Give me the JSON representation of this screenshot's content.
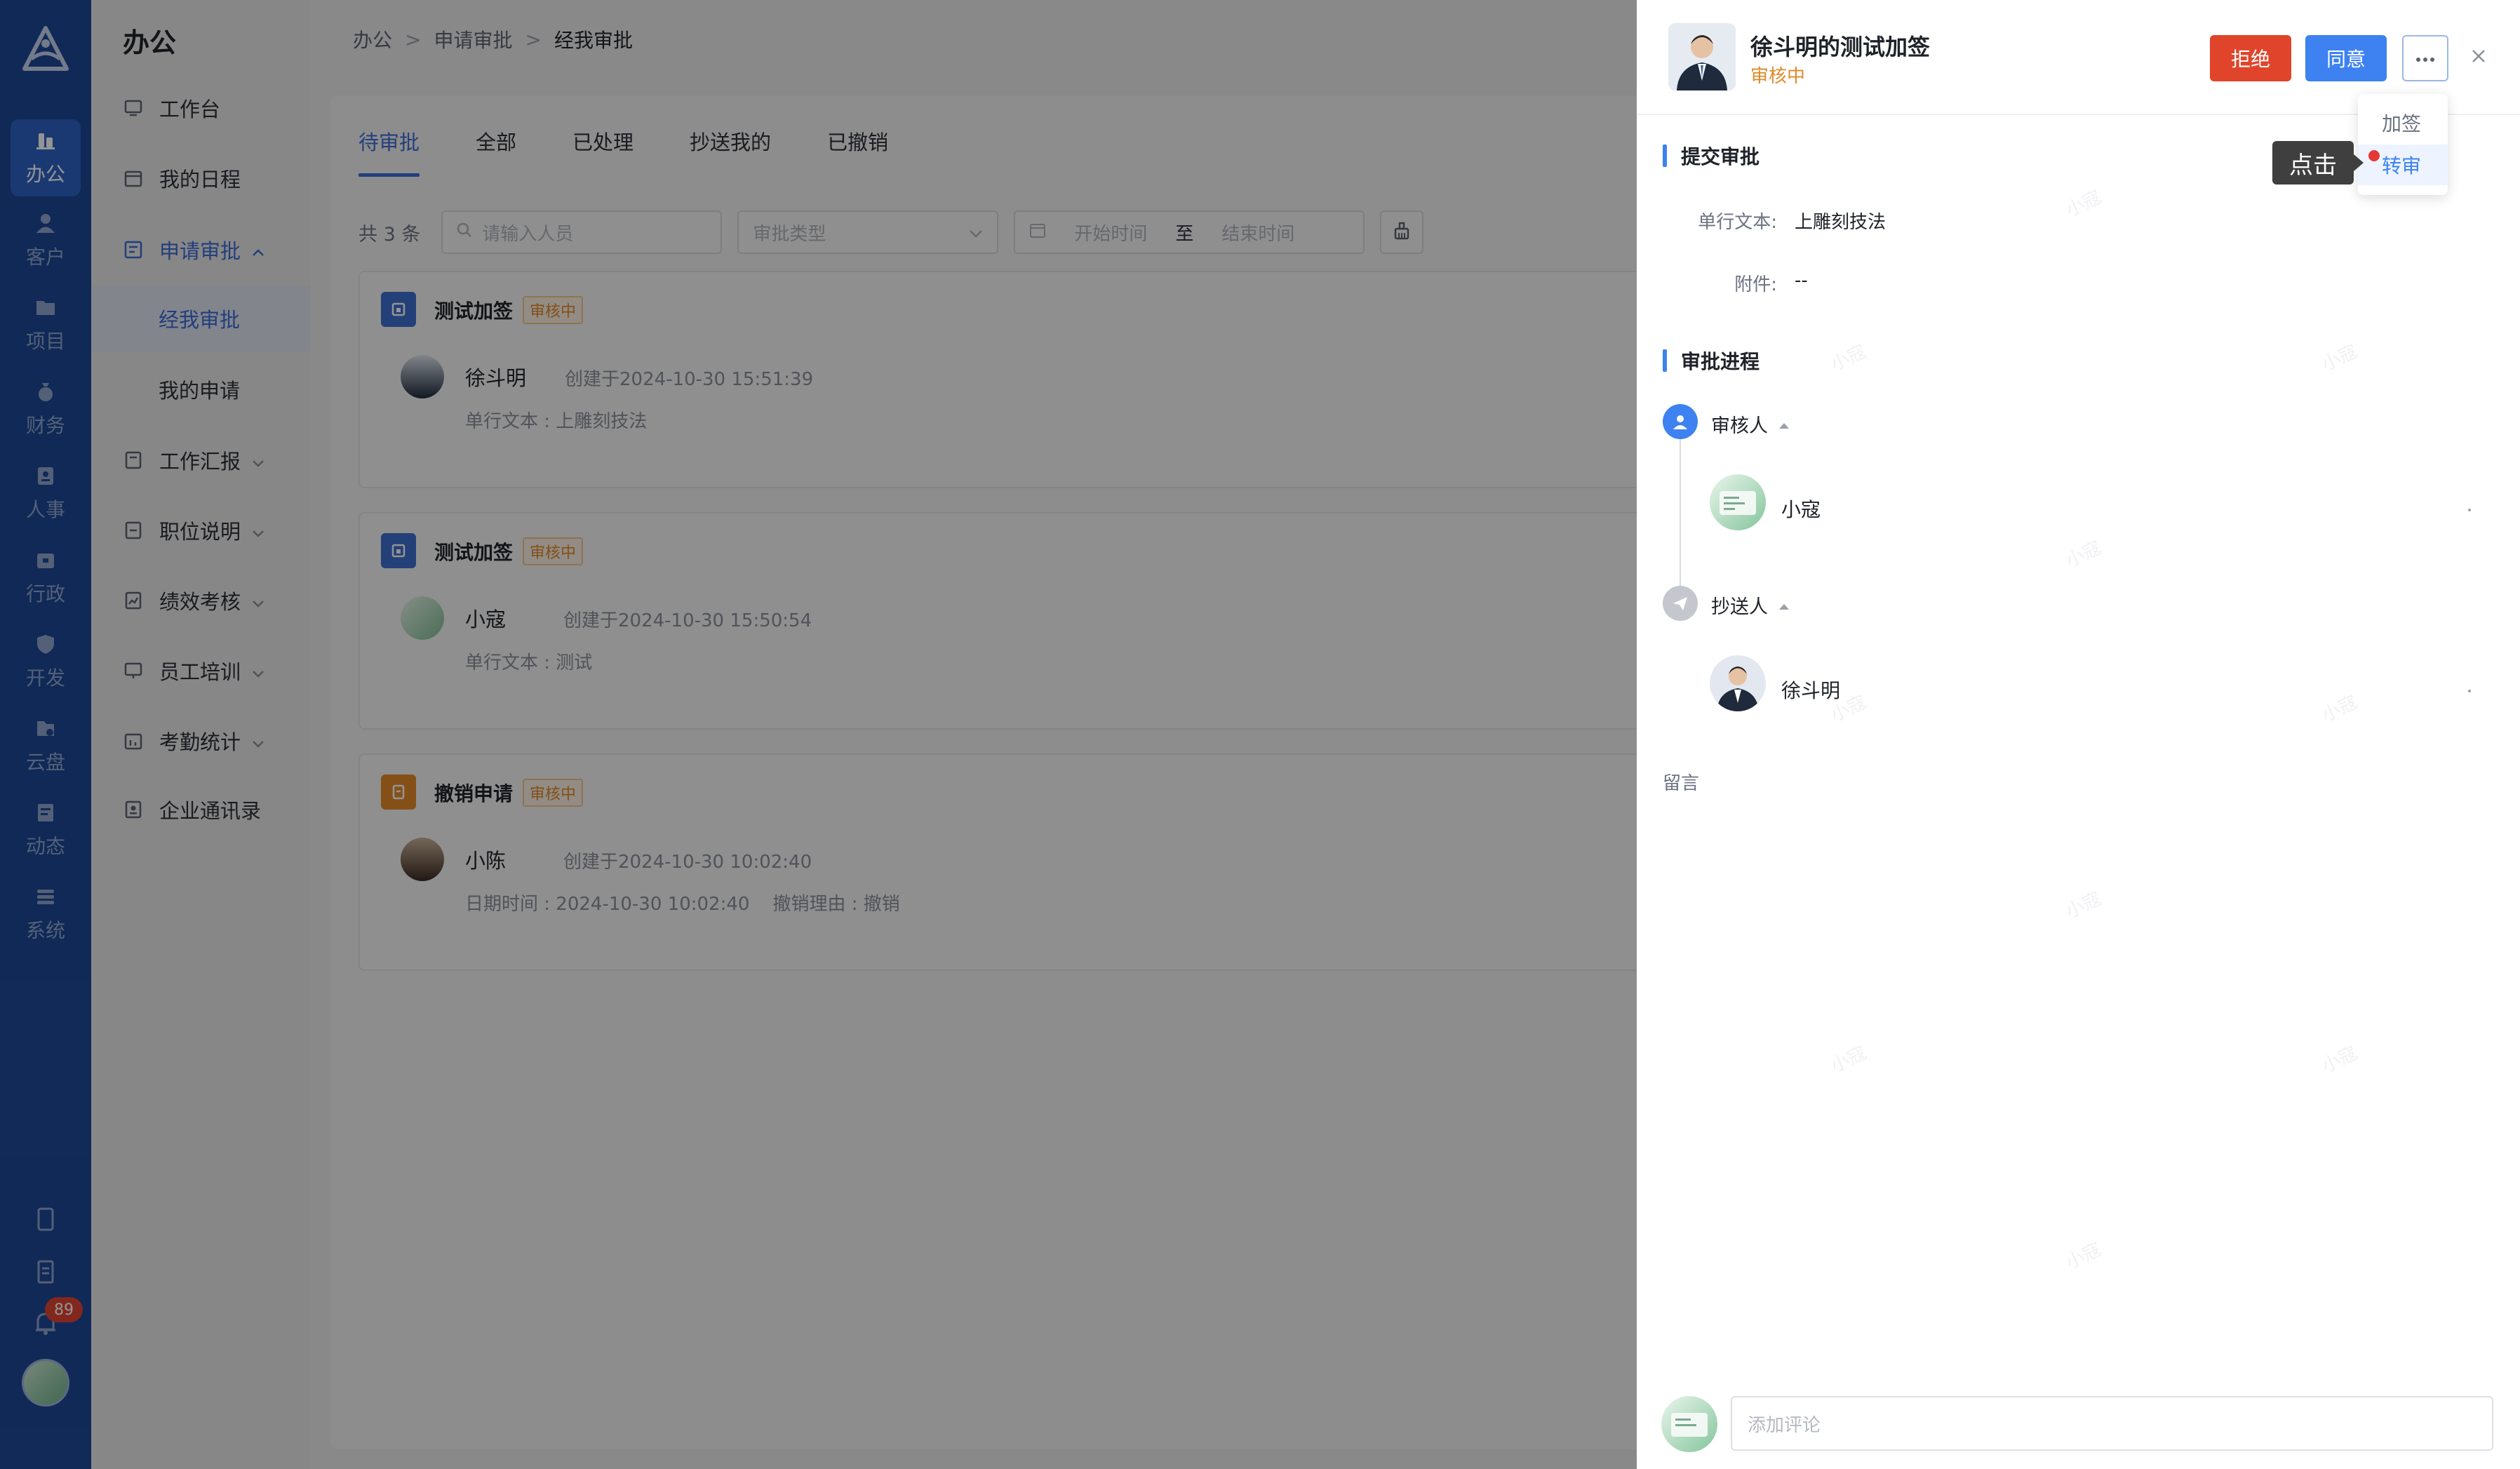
{
  "rail": {
    "items": [
      {
        "label": "办公",
        "icon": "briefcase-icon",
        "active": true
      },
      {
        "label": "客户",
        "icon": "user-icon"
      },
      {
        "label": "项目",
        "icon": "folder-icon"
      },
      {
        "label": "财务",
        "icon": "money-bag-icon"
      },
      {
        "label": "人事",
        "icon": "id-badge-icon"
      },
      {
        "label": "行政",
        "icon": "admin-folder-icon"
      },
      {
        "label": "开发",
        "icon": "shield-icon"
      },
      {
        "label": "云盘",
        "icon": "cloud-folder-icon"
      },
      {
        "label": "动态",
        "icon": "feed-icon"
      },
      {
        "label": "系统",
        "icon": "settings-icon"
      }
    ],
    "notification_count": "89"
  },
  "sidebar": {
    "title": "办公",
    "items": [
      {
        "label": "工作台",
        "icon": "monitor-icon"
      },
      {
        "label": "我的日程",
        "icon": "calendar-icon"
      },
      {
        "label": "申请审批",
        "icon": "approval-icon",
        "expanded": true
      },
      {
        "label": "工作汇报",
        "icon": "report-icon"
      },
      {
        "label": "职位说明",
        "icon": "document-icon"
      },
      {
        "label": "绩效考核",
        "icon": "chart-icon"
      },
      {
        "label": "员工培训",
        "icon": "training-icon"
      },
      {
        "label": "考勤统计",
        "icon": "attendance-icon"
      },
      {
        "label": "企业通讯录",
        "icon": "contacts-icon"
      }
    ],
    "sub_items": [
      {
        "label": "经我审批",
        "active": true
      },
      {
        "label": "我的申请"
      }
    ]
  },
  "breadcrumb": [
    "办公",
    "申请审批",
    "经我审批"
  ],
  "tabs": [
    "待审批",
    "全部",
    "已处理",
    "抄送我的",
    "已撤销"
  ],
  "filters": {
    "count": "共 3 条",
    "person_placeholder": "请输入人员",
    "type_placeholder": "审批类型",
    "start_placeholder": "开始时间",
    "to": "至",
    "end_placeholder": "结束时间"
  },
  "cards": [
    {
      "title": "测试加签",
      "status": "审核中",
      "user": "徐斗明",
      "meta": "创建于2024-10-30 15:51:39",
      "desc": "单行文本 : 上雕刻技法",
      "color": "#3d6fd1"
    },
    {
      "title": "测试加签",
      "status": "审核中",
      "user": "小寇",
      "meta": "创建于2024-10-30 15:50:54",
      "desc": "单行文本 : 测试",
      "color": "#3d6fd1"
    },
    {
      "title": "撤销申请",
      "status": "审核中",
      "user": "小陈",
      "meta": "创建于2024-10-30 10:02:40",
      "desc": "日期时间 : 2024-10-30 10:02:40    撤销理由 : 撤销",
      "color": "#e58a2a"
    }
  ],
  "drawer": {
    "title": "徐斗明的测试加签",
    "status": "审核中",
    "reject_label": "拒绝",
    "agree_label": "同意",
    "more_menu": [
      "加签",
      "转审"
    ],
    "tooltip": "点击",
    "section_submit": "提交审批",
    "fields": [
      {
        "label": "单行文本:",
        "value": "上雕刻技法"
      },
      {
        "label": "附件:",
        "value": "--"
      }
    ],
    "section_progress": "审批进程",
    "reviewer_label": "审核人",
    "reviewer_name": "小寇",
    "cc_label": "抄送人",
    "cc_name": "徐斗明",
    "leave_message": "留言",
    "comment_placeholder": "添加评论",
    "watermark": "小寇"
  },
  "colors": {
    "rail_bg": "#1d4896",
    "primary": "#3d82f0",
    "reject": "#e0452b",
    "status_orange": "#e08a2a"
  }
}
